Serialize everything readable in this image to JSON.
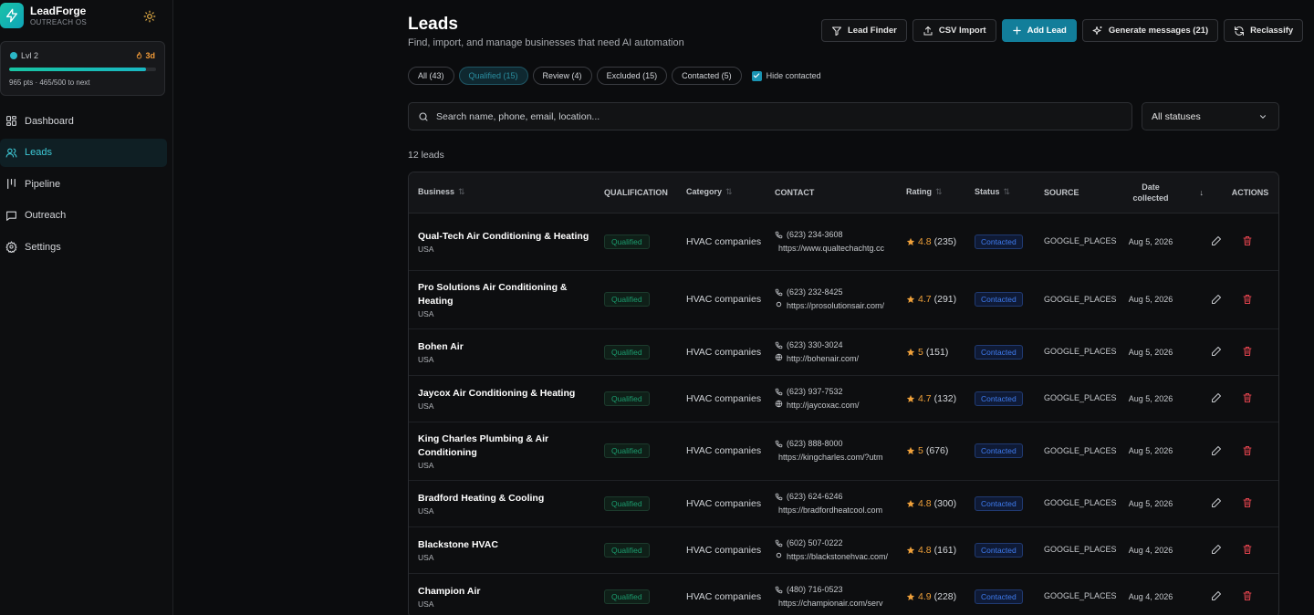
{
  "brand": {
    "name": "LeadForge",
    "subtitle": "OUTREACH OS"
  },
  "level": {
    "label": "Lvl 2",
    "streak": "3d",
    "progress": 0.93,
    "points_text": "965 pts · 465/500 to next"
  },
  "nav": [
    {
      "label": "Dashboard",
      "icon": "dashboard-icon",
      "active": false
    },
    {
      "label": "Leads",
      "icon": "users-icon",
      "active": true
    },
    {
      "label": "Pipeline",
      "icon": "pipeline-icon",
      "active": false
    },
    {
      "label": "Outreach",
      "icon": "message-icon",
      "active": false
    },
    {
      "label": "Settings",
      "icon": "gear-icon",
      "active": false
    }
  ],
  "page": {
    "title": "Leads",
    "subtitle": "Find, import, and manage businesses that need AI automation"
  },
  "toolbar": {
    "lead_finder": "Lead Finder",
    "csv_import": "CSV Import",
    "add_lead": "Add Lead",
    "generate_messages": "Generate messages (21)",
    "reclassify": "Reclassify"
  },
  "filters": {
    "chips": [
      {
        "label": "All (43)",
        "active": false
      },
      {
        "label": "Qualified (15)",
        "active": true
      },
      {
        "label": "Review (4)",
        "active": false
      },
      {
        "label": "Excluded (15)",
        "active": false
      },
      {
        "label": "Contacted (5)",
        "active": false
      }
    ],
    "hide_contacted_label": "Hide contacted",
    "hide_contacted_checked": true
  },
  "search": {
    "placeholder": "Search name, phone, email, location..."
  },
  "status_filter": {
    "selected": "All statuses"
  },
  "lead_count": "12 leads",
  "table": {
    "headers": {
      "business": "Business",
      "qualification": "QUALIFICATION",
      "category": "Category",
      "contact": "CONTACT",
      "rating": "Rating",
      "status": "Status",
      "source": "SOURCE",
      "date_line1": "Date",
      "date_line2": "collected",
      "actions": "ACTIONS"
    },
    "rows": [
      {
        "name": "Qual-Tech Air Conditioning & Heating",
        "country": "USA",
        "qualification": "Qualified",
        "category": "HVAC companies",
        "phone": "(623) 234-3608",
        "url": "https://www.qualtechachtg.cc",
        "url_icon": "none",
        "rating": "4.8",
        "reviews": "(235)",
        "status": "Contacted",
        "source": "GOOGLE_PLACES",
        "date": "Aug 5, 2026",
        "height": 63
      },
      {
        "name": "Pro Solutions Air Conditioning & Heating",
        "country": "USA",
        "qualification": "Qualified",
        "category": "HVAC companies",
        "phone": "(623) 232-8425",
        "url": "https://prosolutionsair.com/",
        "url_icon": "dot",
        "rating": "4.7",
        "reviews": "(291)",
        "status": "Contacted",
        "source": "GOOGLE_PLACES",
        "date": "Aug 5, 2026",
        "height": 64
      },
      {
        "name": "Bohen Air",
        "country": "USA",
        "qualification": "Qualified",
        "category": "HVAC companies",
        "phone": "(623) 330-3024",
        "url": "http://bohenair.com/",
        "url_icon": "globe",
        "rating": "5",
        "reviews": "(151)",
        "status": "Contacted",
        "source": "GOOGLE_PLACES",
        "date": "Aug 5, 2026",
        "height": 51
      },
      {
        "name": "Jaycox Air Conditioning & Heating",
        "country": "USA",
        "qualification": "Qualified",
        "category": "HVAC companies",
        "phone": "(623) 937-7532",
        "url": "http://jaycoxac.com/",
        "url_icon": "globe",
        "rating": "4.7",
        "reviews": "(132)",
        "status": "Contacted",
        "source": "GOOGLE_PLACES",
        "date": "Aug 5, 2026",
        "height": 51
      },
      {
        "name": "King Charles Plumbing & Air Conditioning",
        "country": "USA",
        "qualification": "Qualified",
        "category": "HVAC companies",
        "phone": "(623) 888-8000",
        "url": "https://kingcharles.com/?utm",
        "url_icon": "none",
        "rating": "5",
        "reviews": "(676)",
        "status": "Contacted",
        "source": "GOOGLE_PLACES",
        "date": "Aug 5, 2026",
        "height": 64
      },
      {
        "name": "Bradford Heating & Cooling",
        "country": "USA",
        "qualification": "Qualified",
        "category": "HVAC companies",
        "phone": "(623) 624-6246",
        "url": "https://bradfordheatcool.com",
        "url_icon": "none",
        "rating": "4.8",
        "reviews": "(300)",
        "status": "Contacted",
        "source": "GOOGLE_PLACES",
        "date": "Aug 5, 2026",
        "height": 51
      },
      {
        "name": "Blackstone HVAC",
        "country": "USA",
        "qualification": "Qualified",
        "category": "HVAC companies",
        "phone": "(602) 507-0222",
        "url": "https://blackstonehvac.com/",
        "url_icon": "dot",
        "rating": "4.8",
        "reviews": "(161)",
        "status": "Contacted",
        "source": "GOOGLE_PLACES",
        "date": "Aug 4, 2026",
        "height": 51
      },
      {
        "name": "Champion Air",
        "country": "USA",
        "qualification": "Qualified",
        "category": "HVAC companies",
        "phone": "(480) 716-0523",
        "url": "https://championair.com/serv",
        "url_icon": "none",
        "rating": "4.9",
        "reviews": "(228)",
        "status": "Contacted",
        "source": "GOOGLE_PLACES",
        "date": "Aug 4, 2026",
        "height": 51
      }
    ]
  },
  "colors": {
    "accent": "#127e9a",
    "active_nav": "#3ec9d6",
    "qualified": "#1b9c6e",
    "contacted": "#3f7cf0",
    "star": "#f0a13a",
    "delete": "#e0434d"
  }
}
